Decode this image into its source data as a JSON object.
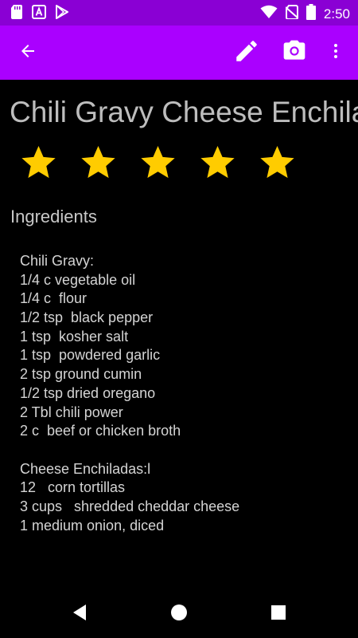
{
  "status_bar": {
    "time": "2:50",
    "left_icons": [
      "sd-card-icon",
      "a-notification-icon",
      "play-store-icon"
    ],
    "right_icons": [
      "wifi-icon",
      "no-sim-icon",
      "battery-icon"
    ]
  },
  "toolbar": {
    "back_icon": "arrow-back-icon",
    "edit_icon": "pencil-icon",
    "camera_icon": "camera-icon",
    "more_icon": "more-vert-icon",
    "color": "#aa00ff"
  },
  "recipe": {
    "title": "Chili Gravy Cheese Enchiladas",
    "rating": 5,
    "rating_max": 5,
    "star_color": "#ffcc00"
  },
  "ingredients": {
    "heading": "Ingredients",
    "lines": [
      "Chili Gravy:",
      "1/4 c vegetable oil",
      "1/4 c  flour",
      "1/2 tsp  black pepper",
      "1 tsp  kosher salt",
      "1 tsp  powdered garlic",
      "2 tsp ground cumin",
      "1/2 tsp dried oregano",
      "2 Tbl chili power",
      "2 c  beef or chicken broth",
      "",
      "Cheese Enchiladas:l",
      "12   corn tortillas",
      "3 cups   shredded cheddar cheese",
      "1 medium onion, diced"
    ]
  },
  "nav_bar": {
    "back_icon": "nav-back-icon",
    "home_icon": "nav-home-icon",
    "recents_icon": "nav-recents-icon"
  }
}
